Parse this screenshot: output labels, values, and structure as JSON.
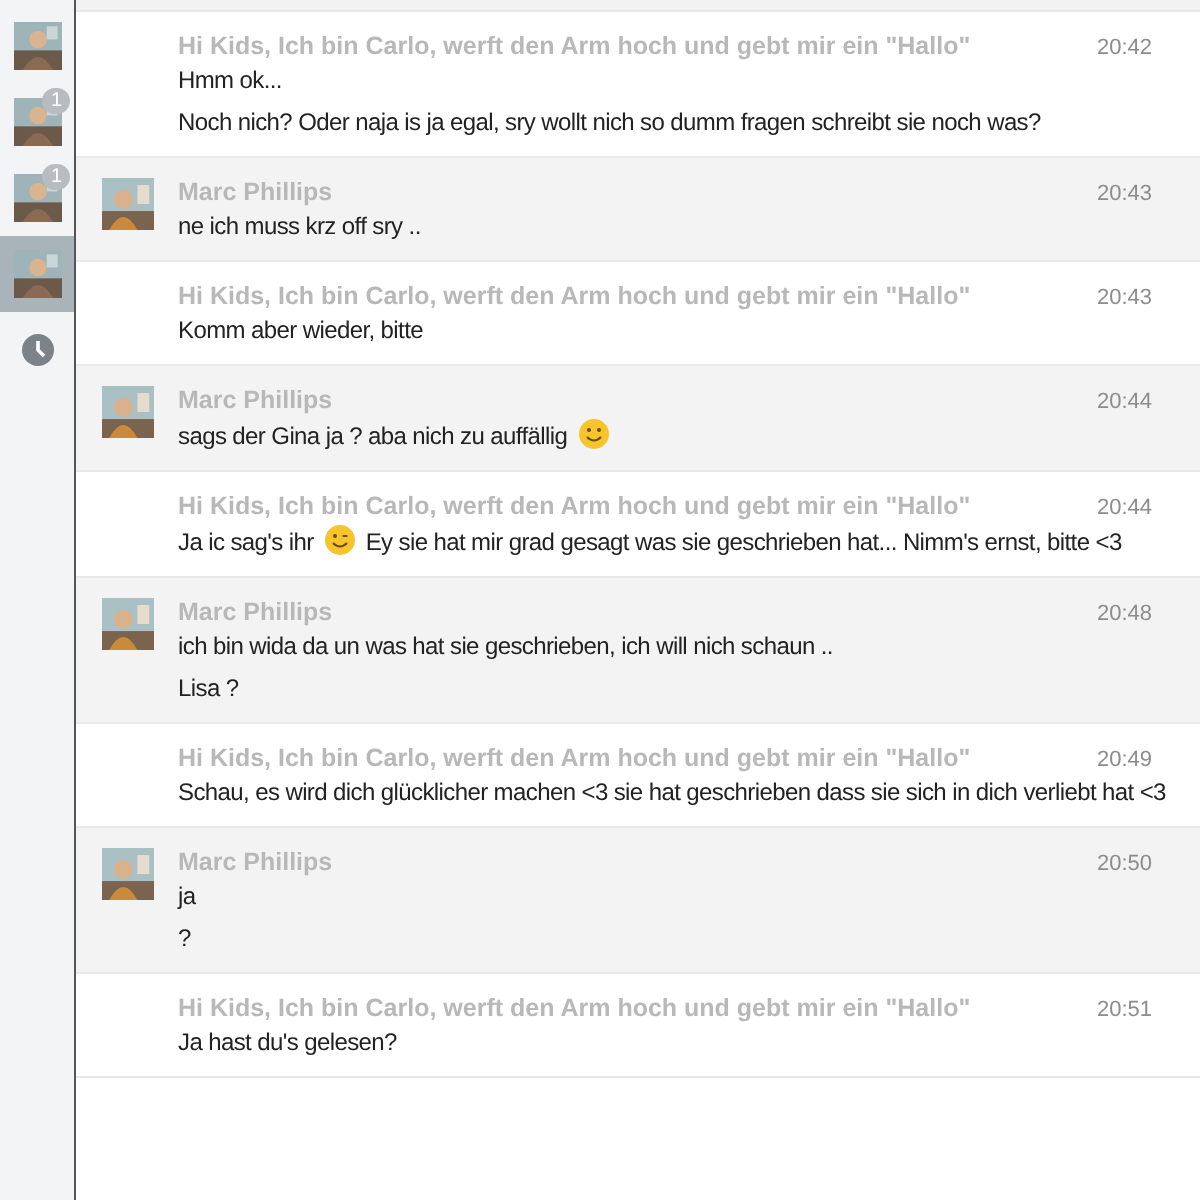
{
  "sidebar": {
    "items": [
      {
        "kind": "avatar",
        "selected": false
      },
      {
        "kind": "avatar",
        "badge": "1",
        "selected": false
      },
      {
        "kind": "avatar",
        "badge": "1",
        "selected": false
      },
      {
        "kind": "avatar",
        "selected": true
      },
      {
        "kind": "clock",
        "selected": false
      }
    ]
  },
  "messages": [
    {
      "sender": "Hi Kids, Ich bin Carlo, werft den Arm hoch und gebt mir ein \"Hallo\"",
      "avatar": false,
      "time": "20:42",
      "lines": [
        [
          {
            "kind": "text",
            "text": "Hmm ok..."
          }
        ],
        [
          {
            "kind": "text",
            "text": "Noch nich? Oder naja is ja egal, sry wollt nich so dumm fragen schreibt sie noch was?"
          }
        ]
      ]
    },
    {
      "sender": "Marc Phillips",
      "avatar": true,
      "time": "20:43",
      "lines": [
        [
          {
            "kind": "text",
            "text": "ne ich muss krz off sry .."
          }
        ]
      ]
    },
    {
      "sender": "Hi Kids, Ich bin Carlo, werft den Arm hoch und gebt mir ein \"Hallo\"",
      "avatar": false,
      "time": "20:43",
      "lines": [
        [
          {
            "kind": "text",
            "text": "Komm aber wieder, bitte"
          }
        ]
      ]
    },
    {
      "sender": "Marc Phillips",
      "avatar": true,
      "time": "20:44",
      "lines": [
        [
          {
            "kind": "text",
            "text": "sags der Gina ja ? aba nich zu auffällig"
          },
          {
            "kind": "smile"
          }
        ]
      ]
    },
    {
      "sender": "Hi Kids, Ich bin Carlo, werft den Arm hoch und gebt mir ein \"Hallo\"",
      "avatar": false,
      "time": "20:44",
      "lines": [
        [
          {
            "kind": "text",
            "text": "Ja ic sag's ihr"
          },
          {
            "kind": "wink"
          },
          {
            "kind": "text",
            "text": "Ey sie hat mir grad gesagt was sie geschrieben hat... Nimm's ernst, bitte <3"
          }
        ]
      ]
    },
    {
      "sender": "Marc Phillips",
      "avatar": true,
      "time": "20:48",
      "lines": [
        [
          {
            "kind": "text",
            "text": "ich bin wida da un was hat sie geschrieben, ich will nich schaun .."
          }
        ],
        [
          {
            "kind": "text",
            "text": "Lisa ?"
          }
        ]
      ]
    },
    {
      "sender": "Hi Kids, Ich bin Carlo, werft den Arm hoch und gebt mir ein \"Hallo\"",
      "avatar": false,
      "time": "20:49",
      "lines": [
        [
          {
            "kind": "text",
            "text": "Schau, es wird dich glücklicher machen <3 sie hat geschrieben dass sie sich in dich verliebt hat <3"
          }
        ]
      ]
    },
    {
      "sender": "Marc Phillips",
      "avatar": true,
      "time": "20:50",
      "lines": [
        [
          {
            "kind": "text",
            "text": "ja"
          }
        ],
        [
          {
            "kind": "text",
            "text": "?"
          }
        ]
      ]
    },
    {
      "sender": "Hi Kids, Ich bin Carlo, werft den Arm hoch und gebt mir ein \"Hallo\"",
      "avatar": false,
      "time": "20:51",
      "lines": [
        [
          {
            "kind": "text",
            "text": "Ja hast du's gelesen?"
          }
        ]
      ]
    }
  ]
}
